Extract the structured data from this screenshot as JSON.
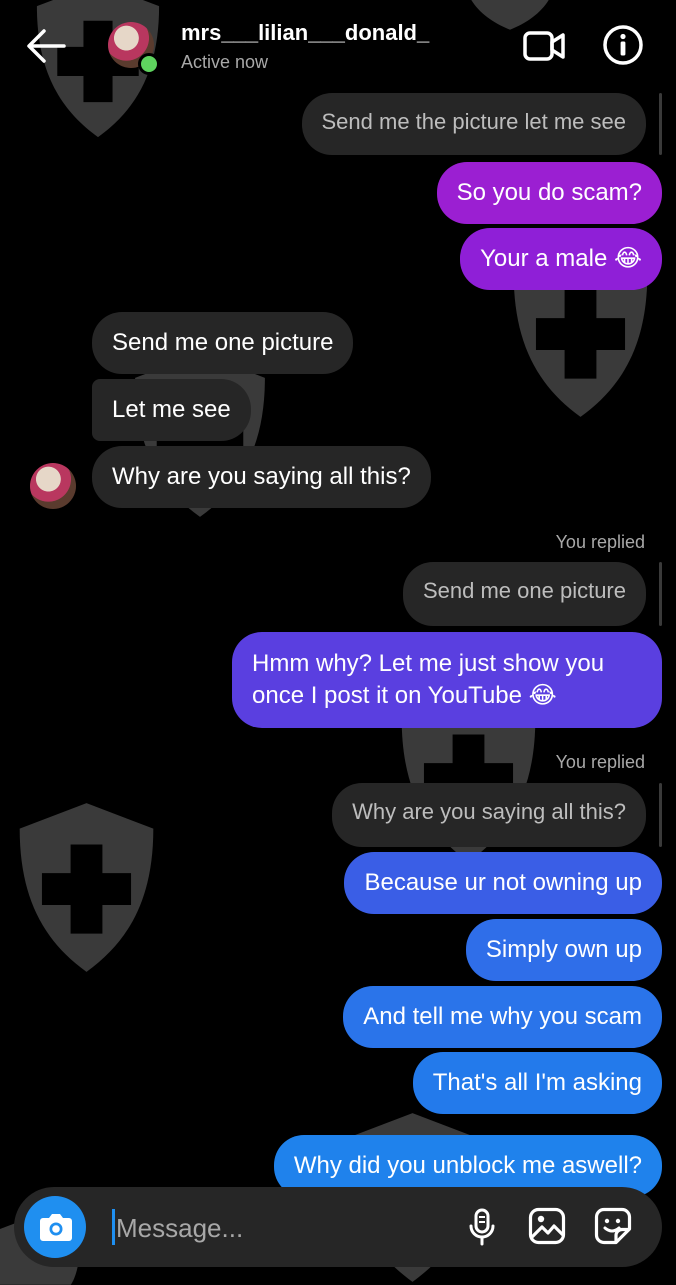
{
  "header": {
    "username": "mrs___lilian___donald_",
    "status": "Active now"
  },
  "messages": {
    "quote1": "Send me the picture let me see",
    "m1": "So you do scam?",
    "m2": "Your a male 😂",
    "m3": "Send me one picture",
    "m4": "Let me see",
    "m5": "Why are you saying all this?",
    "replied1": "You replied",
    "quote2": "Send me one picture",
    "m6_line1": "Hmm why? Let me just show you",
    "m6_line2": "once I post it on YouTube 😂",
    "replied2": "You replied",
    "quote3": "Why are you saying all this?",
    "m7": "Because ur not owning up",
    "m8": "Simply own up",
    "m9": "And tell me why you scam",
    "m10": "That's all I'm asking",
    "m11": "Why did you unblock me aswell?"
  },
  "composer": {
    "placeholder": "Message..."
  },
  "colors": {
    "outgoing_top": "#9b1fd2",
    "outgoing_mid": "#5a3fe0",
    "outgoing_bottom": "#1f82ec",
    "incoming": "#262626",
    "accent": "#1f8ff0"
  },
  "icons": [
    "back-arrow-icon",
    "video-call-icon",
    "info-icon",
    "camera-icon",
    "microphone-icon",
    "gallery-icon",
    "sticker-icon",
    "shield-watermark-icon"
  ]
}
